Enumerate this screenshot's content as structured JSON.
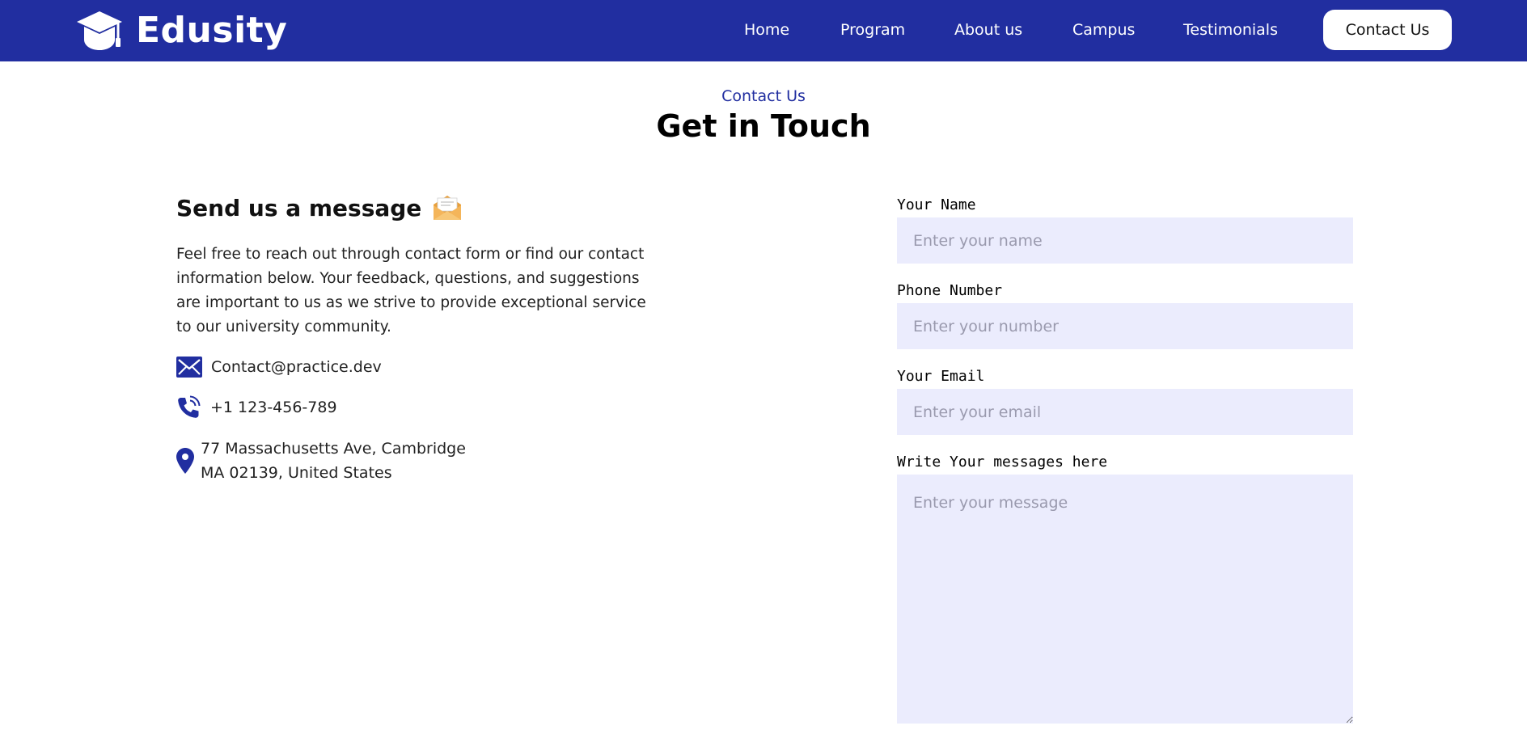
{
  "brand": {
    "name": "Edusity",
    "logo_icon": "graduation-cap-icon",
    "nav_color": "#212ea0"
  },
  "nav": {
    "links": [
      "Home",
      "Program",
      "About us",
      "Campus",
      "Testimonials"
    ],
    "cta_label": "Contact Us"
  },
  "header": {
    "kicker": "Contact Us",
    "title": "Get in Touch"
  },
  "message": {
    "heading": "Send us a message",
    "heading_icon": "envelope-emoji-icon",
    "paragraph": "Feel free to reach out through contact form or find our contact information below. Your feedback, questions, and suggestions are important to us as we strive to provide exceptional service to our university community."
  },
  "contact": {
    "email": "Contact@practice.dev",
    "phone": "+1 123-456-789",
    "address_line1": "77 Massachusetts Ave, Cambridge",
    "address_line2": "MA 02139, United States"
  },
  "form": {
    "name_label": "Your Name",
    "name_placeholder": "Enter your name",
    "phone_label": "Phone Number",
    "phone_placeholder": "Enter your number",
    "email_label": "Your Email",
    "email_placeholder": "Enter your email",
    "message_label": "Write Your messages here",
    "message_placeholder": "Enter your message"
  }
}
